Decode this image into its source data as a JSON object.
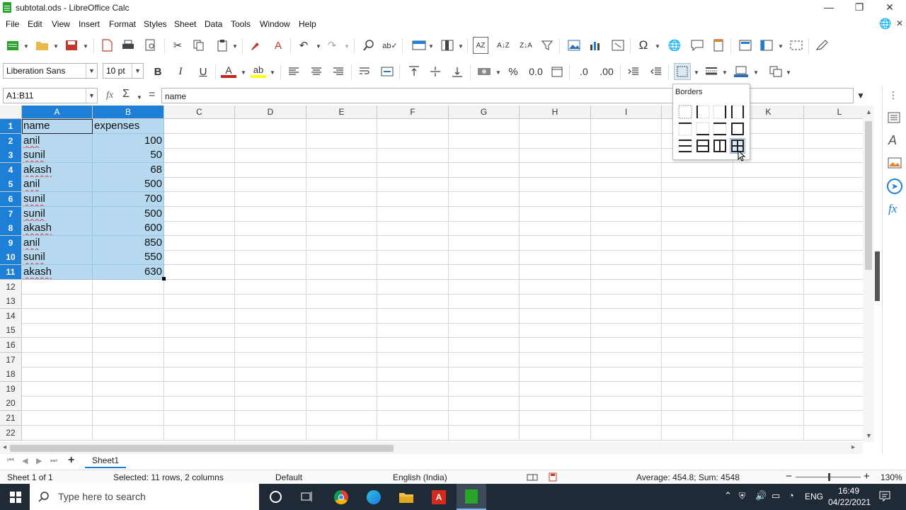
{
  "window": {
    "title": "subtotal.ods - LibreOffice Calc",
    "minimize": "—",
    "restore": "❐",
    "close": "✕"
  },
  "menubar": {
    "items": [
      "File",
      "Edit",
      "View",
      "Insert",
      "Format",
      "Styles",
      "Sheet",
      "Data",
      "Tools",
      "Window",
      "Help"
    ]
  },
  "format_toolbar": {
    "font_name": "Liberation Sans",
    "font_size": "10 pt",
    "bold": "B",
    "italic": "I",
    "underline": "U",
    "percent": "%",
    "number": "0.0",
    "decimal_add": ".0",
    "decimal_del": ".00"
  },
  "formulabar": {
    "name_box": "A1:B11",
    "fx": "fx",
    "sigma": "Σ",
    "equals": "=",
    "content": "name"
  },
  "columns": [
    "A",
    "B",
    "C",
    "D",
    "E",
    "F",
    "G",
    "H",
    "I",
    "J",
    "K",
    "L"
  ],
  "rows": [
    "1",
    "2",
    "3",
    "4",
    "5",
    "6",
    "7",
    "8",
    "9",
    "10",
    "11",
    "12",
    "13",
    "14",
    "15",
    "16",
    "17",
    "18",
    "19",
    "20",
    "21",
    "22"
  ],
  "cells": {
    "header": [
      "name",
      "expenses"
    ],
    "data": [
      [
        "anil",
        "100"
      ],
      [
        "sunil",
        "50"
      ],
      [
        "akash",
        "68"
      ],
      [
        "anil",
        "500"
      ],
      [
        "sunil",
        "700"
      ],
      [
        "sunil",
        "500"
      ],
      [
        "akash",
        "600"
      ],
      [
        "anil",
        "850"
      ],
      [
        "sunil",
        "550"
      ],
      [
        "akash",
        "630"
      ]
    ]
  },
  "borders_popup": {
    "title": "Borders"
  },
  "tabs": {
    "add": "+",
    "sheet1": "Sheet1"
  },
  "statusbar": {
    "sheet": "Sheet 1 of 1",
    "selection": "Selected: 11 rows, 2 columns",
    "style": "Default",
    "language": "English (India)",
    "stats": "Average: 454.8; Sum: 4548",
    "zoom_minus": "−",
    "zoom_plus": "+",
    "zoom": "130%"
  },
  "taskbar": {
    "search_placeholder": "Type here to search",
    "lang": "ENG",
    "time": "16:49",
    "date": "04/22/2021"
  },
  "colors": {
    "selection": "#b7d9f0",
    "header_selected": "#1e7fd6",
    "taskbar": "#1f2a36"
  }
}
